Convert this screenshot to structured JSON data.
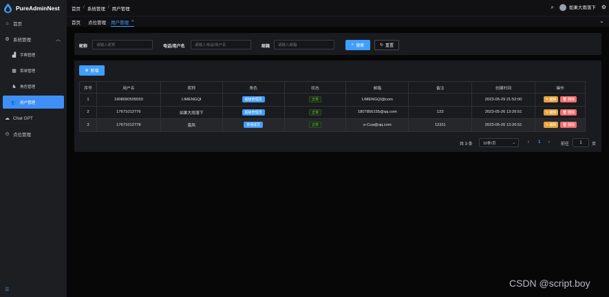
{
  "app": {
    "name": "PureAdminNest"
  },
  "sidebar": {
    "items": [
      {
        "label": "首页"
      },
      {
        "label": "系统管理"
      },
      {
        "label": "字典管理"
      },
      {
        "label": "菜单管理"
      },
      {
        "label": "角色管理"
      },
      {
        "label": "用户管理"
      },
      {
        "label": "Chat GPT"
      },
      {
        "label": "点位管理"
      }
    ]
  },
  "header": {
    "breadcrumb": [
      "首页",
      "系统管理",
      "用户管理"
    ],
    "separator": "/",
    "user": "如果大雨落下"
  },
  "tabs": [
    {
      "label": "首页"
    },
    {
      "label": "点位管理"
    },
    {
      "label": "用户管理"
    }
  ],
  "search": {
    "nickname_label": "昵称",
    "nickname_placeholder": "请输入昵称",
    "phone_label": "电话/用户名",
    "phone_placeholder": "请输入电话/用户名",
    "email_label": "邮箱",
    "email_placeholder": "请输入邮箱",
    "search_btn": "搜索",
    "reset_btn": "重置"
  },
  "toolbar": {
    "add_btn": "新增"
  },
  "table": {
    "headers": [
      "序号",
      "用户名",
      "昵称",
      "角色",
      "状态",
      "邮箱",
      "备注",
      "创建时间",
      "操作"
    ],
    "rows": [
      {
        "no": "1",
        "username": "1908090505550",
        "nickname": "LIMENGQI",
        "role": "超级管理员",
        "status": "正常",
        "email": "LIMENGQI@com",
        "remark": "",
        "created": "2023-05-29 21:52:00"
      },
      {
        "no": "2",
        "username": "17671012776",
        "nickname": "如果大雨落下",
        "role": "超级管理员",
        "status": "正常",
        "email": "1807856155@qq.com",
        "remark": "123",
        "created": "2023-05-26 13:26:51"
      },
      {
        "no": "3",
        "username": "17671012778",
        "nickname": "南风",
        "role": "普通成员",
        "status": "正常",
        "email": "e-Cua@qq.com",
        "remark": "12311",
        "created": "2023-05-26 13:26:51"
      }
    ],
    "edit_label": "编辑",
    "delete_label": "删除"
  },
  "pagination": {
    "total": "共 3 条",
    "page_size": "10条/页",
    "current": "1",
    "goto_label": "前往",
    "goto_value": "1",
    "page_unit": "页"
  },
  "watermark": "CSDN @script.boy",
  "colors": {
    "accent": "#409eff",
    "edit": "#e6a23c",
    "delete": "#f56c6c",
    "success": "#67c23a"
  }
}
